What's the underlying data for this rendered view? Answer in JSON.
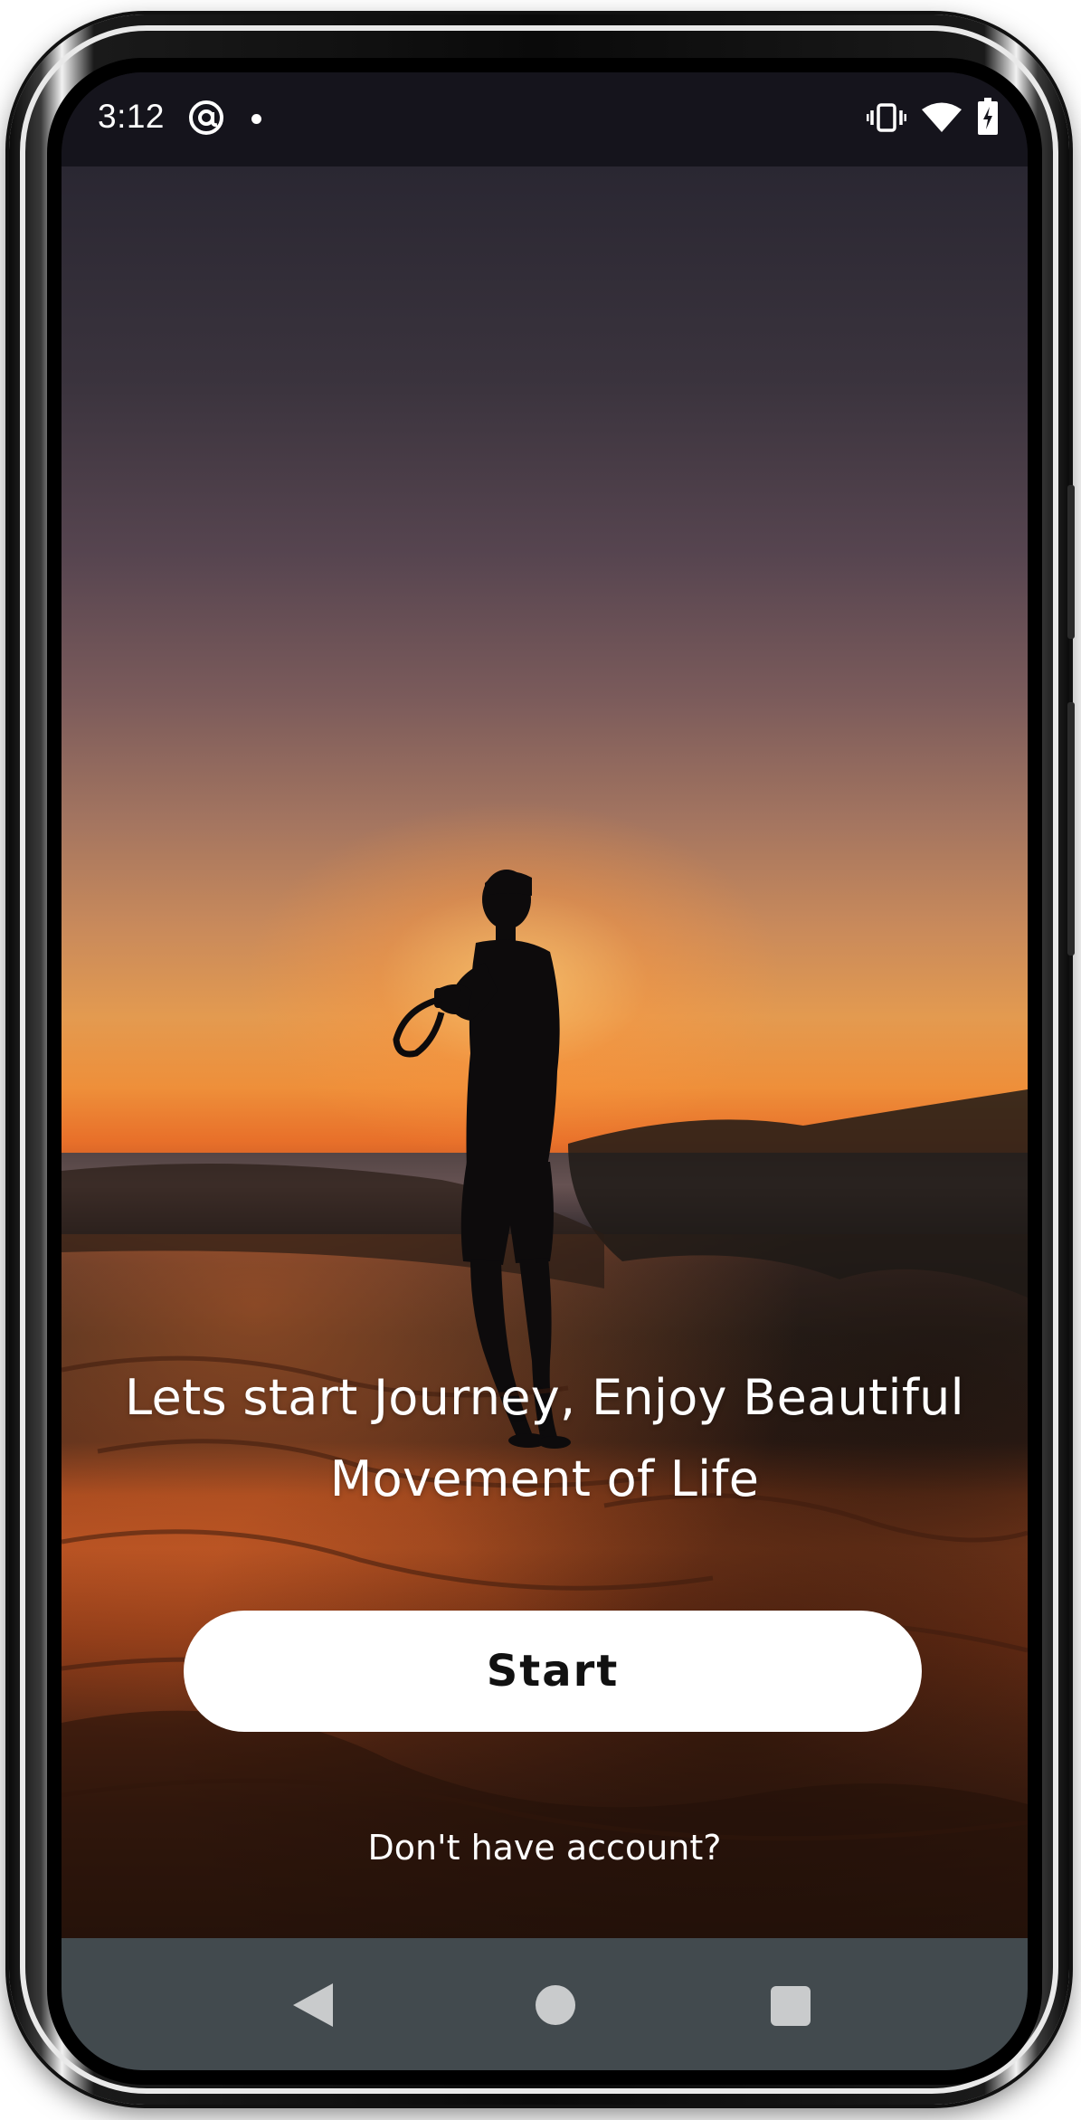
{
  "status_bar": {
    "time": "3:12",
    "left_icons": [
      "at-sign-icon",
      "notification-dot-icon"
    ],
    "right_icons": [
      "vibrate-icon",
      "wifi-icon",
      "battery-charging-icon"
    ]
  },
  "hero": {
    "image_subject": "silhouette-photographer-sunset-dunes-image"
  },
  "main": {
    "tagline": "Lets start Journey, Enjoy Beautiful Movement of Life",
    "start_label": "Start",
    "account_link": "Don't have account?"
  },
  "nav_bar": {
    "icons": [
      "back-icon",
      "home-icon",
      "recents-icon"
    ]
  },
  "colors": {
    "nav_bar_bg": "#424a4e",
    "status_bar_bg": "#15141c",
    "button_bg": "#ffffff",
    "button_text": "#111111",
    "text": "#ffffff"
  }
}
